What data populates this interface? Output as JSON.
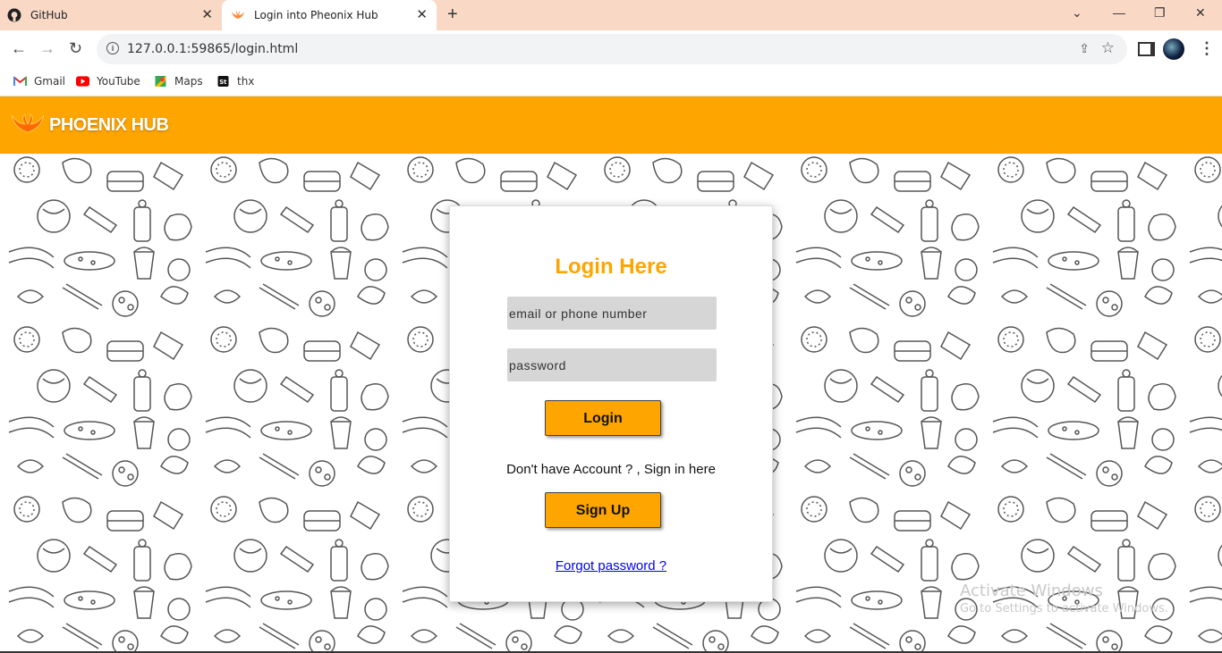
{
  "browser": {
    "tabs": [
      {
        "title": "GitHub",
        "icon": "github-icon"
      },
      {
        "title": "Login into Pheonix Hub",
        "icon": "phoenix-icon",
        "active": true
      }
    ],
    "new_tab": "+",
    "window_controls": {
      "minimize": "—",
      "restore": "❐",
      "close": "✕"
    },
    "url": "127.0.0.1:59865/login.html",
    "bookmarks": [
      {
        "label": "Gmail",
        "icon": "gmail-icon"
      },
      {
        "label": "YouTube",
        "icon": "youtube-icon"
      },
      {
        "label": "Maps",
        "icon": "maps-icon"
      },
      {
        "label": "thx",
        "icon": "st-icon"
      }
    ]
  },
  "header": {
    "brand": "PHOENIX HUB",
    "color": "#ffa500"
  },
  "login": {
    "title": "Login Here",
    "email_placeholder": "email or phone number",
    "password_placeholder": "password",
    "login_label": "Login",
    "prompt": "Don't have Account ? , Sign in here",
    "signup_label": "Sign Up",
    "forgot_label": "Forgot password ?"
  },
  "watermark": {
    "line1": "Activate Windows",
    "line2": "Go to Settings to activate Windows."
  }
}
